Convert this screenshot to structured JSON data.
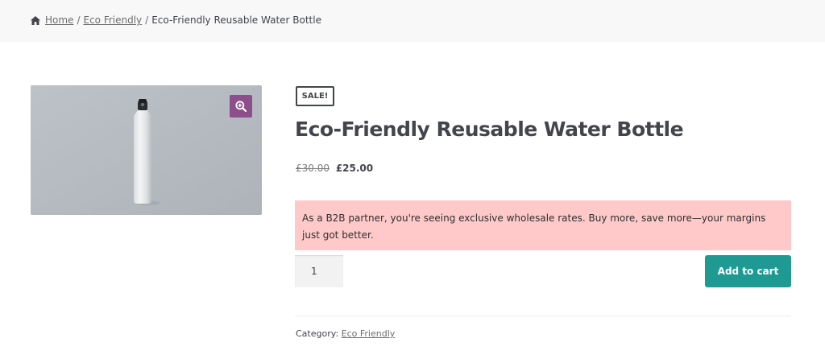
{
  "breadcrumb": {
    "home_icon": "home-icon",
    "home": "Home",
    "separator": "/",
    "category": "Eco Friendly",
    "current": "Eco-Friendly Reusable Water Bottle"
  },
  "product": {
    "image_alt": "Eco-Friendly Reusable Water Bottle",
    "zoom_icon": "zoom-in-icon",
    "sale_badge": "SALE!",
    "title": "Eco-Friendly Reusable Water Bottle",
    "old_price": "£30.00",
    "new_price": "£25.00",
    "notice": "As a B2B partner, you're seeing exclusive wholesale rates. Buy more, save more—your margins just got better.",
    "quantity": "1",
    "add_to_cart": "Add to cart",
    "category_label": "Category:",
    "category_link": "Eco Friendly"
  },
  "colors": {
    "accent_purple": "#8d4f8b",
    "button_teal": "#1f9a92",
    "notice_bg": "#ffc9c9",
    "breadcrumb_bg": "#f8f8f8"
  }
}
